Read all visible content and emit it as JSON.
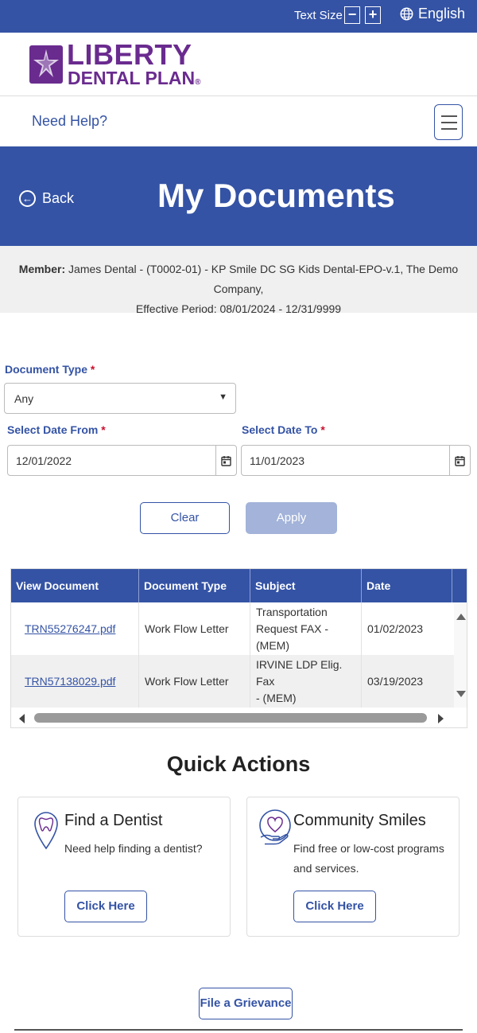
{
  "topbar": {
    "text_size_label": "Text Size",
    "decrease_label": "−",
    "increase_label": "+",
    "language": "English",
    "bg_color": "#3453a5"
  },
  "brand": {
    "line1": "LIBERTY",
    "line2": "DENTAL PLAN",
    "line2_mark": "®",
    "color": "#6a2b8f"
  },
  "help": {
    "label": "Need Help?"
  },
  "hero": {
    "back_label": "Back",
    "title": "My Documents"
  },
  "member": {
    "label": "Member:",
    "line1": "James Dental - (T0002-01) - KP Smile DC SG Kids Dental-EPO-v.1, The Demo Company,",
    "line2": "Effective Period: 08/01/2024 - 12/31/9999"
  },
  "filters": {
    "document_type_label": "Document Type",
    "document_type_value": "Any",
    "date_from_label": "Select Date From",
    "date_from_value": "12/01/2022",
    "date_to_label": "Select Date To",
    "date_to_value": "11/01/2023",
    "required_mark": "*",
    "clear_label": "Clear",
    "apply_label": "Apply"
  },
  "table": {
    "columns": [
      "View Document",
      "Document Type",
      "Subject",
      "Date"
    ],
    "rows": [
      {
        "file": "TRN55276247.pdf",
        "type": "Work Flow Letter",
        "subject_line1": "Transportation",
        "subject_line2": "Request FAX - (MEM)",
        "date": "01/02/2023"
      },
      {
        "file": "TRN57138029.pdf",
        "type": "Work Flow Letter",
        "subject_line1": "IRVINE LDP Elig. Fax",
        "subject_line2": "- (MEM)",
        "date": "03/19/2023"
      }
    ]
  },
  "quick_actions": {
    "title": "Quick Actions",
    "cards": [
      {
        "title": "Find a Dentist",
        "description": "Need help finding a dentist?",
        "button": "Click Here",
        "icon": "tooth-location-icon"
      },
      {
        "title": "Community Smiles",
        "description": "Find free or low-cost programs and services.",
        "button": "Click Here",
        "icon": "heart-hand-icon"
      }
    ]
  },
  "grievance_label": "File a Grievance"
}
